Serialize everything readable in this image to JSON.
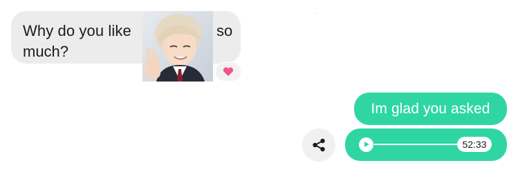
{
  "incoming_message": {
    "line1_before_image": "Why do you like",
    "line1_after_image": "so",
    "line2": "much?",
    "reaction_icon": "heart-icon",
    "reaction_color": "#f0558a"
  },
  "outgoing_message": {
    "text": "Im glad you asked"
  },
  "audio_message": {
    "duration": "52:33",
    "progress": 0,
    "play_icon": "play-icon"
  },
  "share_button": {
    "icon": "share-icon"
  },
  "colors": {
    "incoming_bubble": "#ececec",
    "outgoing_bubble": "#2fd6a3",
    "text_dark": "#1b1b1b"
  }
}
